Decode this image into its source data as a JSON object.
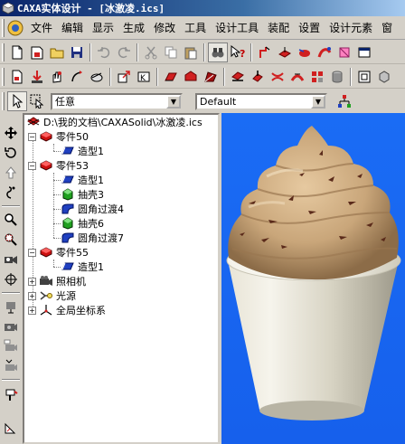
{
  "window": {
    "title": "CAXA实体设计 - [冰激凌.ics]"
  },
  "menu": {
    "items": [
      "文件",
      "编辑",
      "显示",
      "生成",
      "修改",
      "工具",
      "设计工具",
      "装配",
      "设置",
      "设计元素",
      "窗"
    ]
  },
  "selection_bar": {
    "filter_value": "任意",
    "style_value": "Default"
  },
  "tree": {
    "root_label": "D:\\我的文档\\CAXASolid\\冰激凌.ics",
    "part50": {
      "label": "零件50",
      "children": [
        "造型1"
      ]
    },
    "part53": {
      "label": "零件53",
      "children": [
        "造型1",
        "抽壳3",
        "圆角过渡4",
        "抽壳6",
        "圆角过渡7"
      ]
    },
    "part55": {
      "label": "零件55",
      "children": [
        "造型1"
      ]
    },
    "camera": "照相机",
    "light": "光源",
    "global_coords": "全局坐标系"
  },
  "colors": {
    "viewport_bg": "#1866f0",
    "title_bar": "#0a246a",
    "part_icon_red": "#cc1010",
    "feature_icon_blue": "#2040c0",
    "shell_icon_green": "#20a020"
  }
}
